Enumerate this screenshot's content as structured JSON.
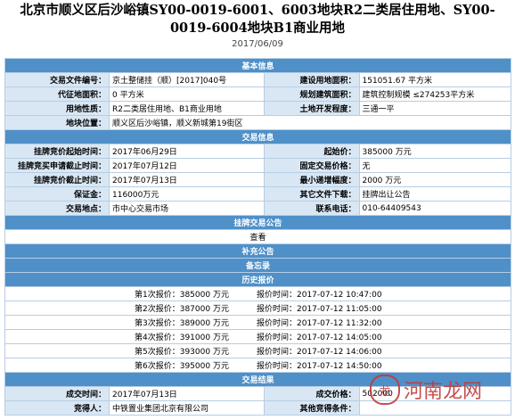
{
  "header": {
    "title": "北京市顺义区后沙峪镇SY00-0019-6001、6003地块R2二类居住用地、SY00-0019-6004地块B1商业用地",
    "date": "2017/06/09"
  },
  "sections": {
    "basic": "基本信息",
    "trade": "交易信息",
    "notice": "挂牌交易公告",
    "supplement": "补充公告",
    "memo": "备忘录",
    "history": "历史报价",
    "result": "交易结果"
  },
  "basic": {
    "row1": {
      "l1": "交易文件编号：",
      "v1": "京土整储挂（顺）[2017]040号",
      "l2": "建设用地面积：",
      "v2": "151051.67 平方米"
    },
    "row2": {
      "l1": "代征地面积：",
      "v1": "0 平方米",
      "l2": "规划建筑面积：",
      "v2": "建筑控制规模 ≤274253平方米"
    },
    "row3": {
      "l1": "用地性质：",
      "v1": "R2二类居住用地、B1商业用地",
      "l2": "土地开发程度：",
      "v2": "三通一平"
    },
    "row4": {
      "l1": "地块位置：",
      "v1": "顺义区后沙峪镇，顺义新城第19街区"
    }
  },
  "trade": {
    "row1": {
      "l1": "挂牌竞价起始时间：",
      "v1": "2017年06月29日",
      "l2": "起始价：",
      "v2": "385000 万元"
    },
    "row2": {
      "l1": "挂牌竞买申请截止时间：",
      "v1": "2017年07月12日",
      "l2": "固定交易价格：",
      "v2": "无"
    },
    "row3": {
      "l1": "挂牌竞价截止时间：",
      "v1": "2017年07月13日",
      "l2": "最小递增幅度：",
      "v2": "2000 万元"
    },
    "row4": {
      "l1": "保证金：",
      "v1": "116000万元",
      "l2": "其它文件下载：",
      "v2": "挂牌出让公告"
    },
    "row5": {
      "l1": "交易地点：",
      "v1": "市中心交易市场",
      "l2": "联系电话：",
      "v2": "010-64409543"
    }
  },
  "notice": {
    "view": "查看"
  },
  "bids": [
    {
      "label": "第1次报价：385000 万元",
      "time": "报价时间：2017-07-12 10:47:00"
    },
    {
      "label": "第2次报价：387000 万元",
      "time": "报价时间：2017-07-12 11:05:00"
    },
    {
      "label": "第3次报价：389000 万元",
      "time": "报价时间：2017-07-12 11:32:00"
    },
    {
      "label": "第4次报价：391000 万元",
      "time": "报价时间：2017-07-12 14:05:00"
    },
    {
      "label": "第5次报价：393000 万元",
      "time": "报价时间：2017-07-12 14:06:00"
    },
    {
      "label": "第6次报价：395000 万元",
      "time": "报价时间：2017-07-12 14:50:00"
    }
  ],
  "result": {
    "row1": {
      "l1": "成交时间：",
      "v1": "2017年07月13日",
      "l2": "成交价格：",
      "v2": "502000"
    },
    "row2": {
      "l1": "竞得人：",
      "v1": "中铁置业集团北京有限公司",
      "l2": "其他竞得条件：",
      "v2": ""
    }
  },
  "watermark": {
    "text": "河南龙网",
    "logo": "龙"
  }
}
